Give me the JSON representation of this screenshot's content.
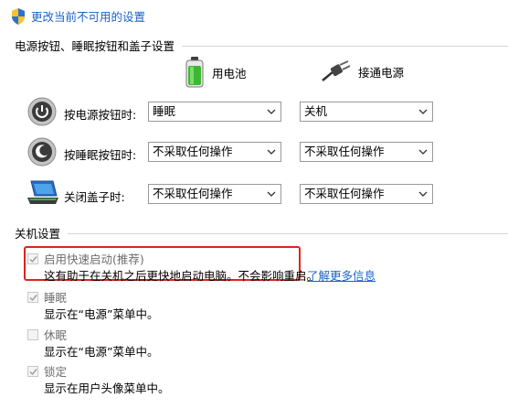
{
  "header": {
    "admin_link": "更改当前不可用的设置",
    "icon": "uac-shield-icon"
  },
  "buttons_section": {
    "title": "电源按钮、睡眠按钮和盖子设置",
    "columns": {
      "battery": {
        "label": "用电池",
        "icon": "battery-icon"
      },
      "plugged": {
        "label": "接通电源",
        "icon": "power-plug-icon"
      }
    },
    "rows": [
      {
        "label": "按电源按钮时:",
        "icon": "power-button-icon",
        "battery": "睡眠",
        "plugged": "关机"
      },
      {
        "label": "按睡眠按钮时:",
        "icon": "sleep-button-icon",
        "battery": "不采取任何操作",
        "plugged": "不采取任何操作"
      },
      {
        "label": "关闭盖子时:",
        "icon": "laptop-lid-icon",
        "battery": "不采取任何操作",
        "plugged": "不采取任何操作"
      }
    ]
  },
  "shutdown_section": {
    "title": "关机设置",
    "options": [
      {
        "label": "启用快速启动(推荐)",
        "checked": true,
        "desc": "这有助于在关机之后更快地启动电脑。不会影响重启。",
        "link": "了解更多信息"
      },
      {
        "label": "睡眠",
        "checked": true,
        "desc": "显示在“电源”菜单中。"
      },
      {
        "label": "休眠",
        "checked": false,
        "desc": "显示在“电源”菜单中。"
      },
      {
        "label": "锁定",
        "checked": true,
        "desc": "显示在用户头像菜单中。"
      }
    ]
  },
  "colors": {
    "link": "#1a63c6",
    "highlight_border": "#e0231b",
    "disabled_text": "#6d6d6d"
  }
}
